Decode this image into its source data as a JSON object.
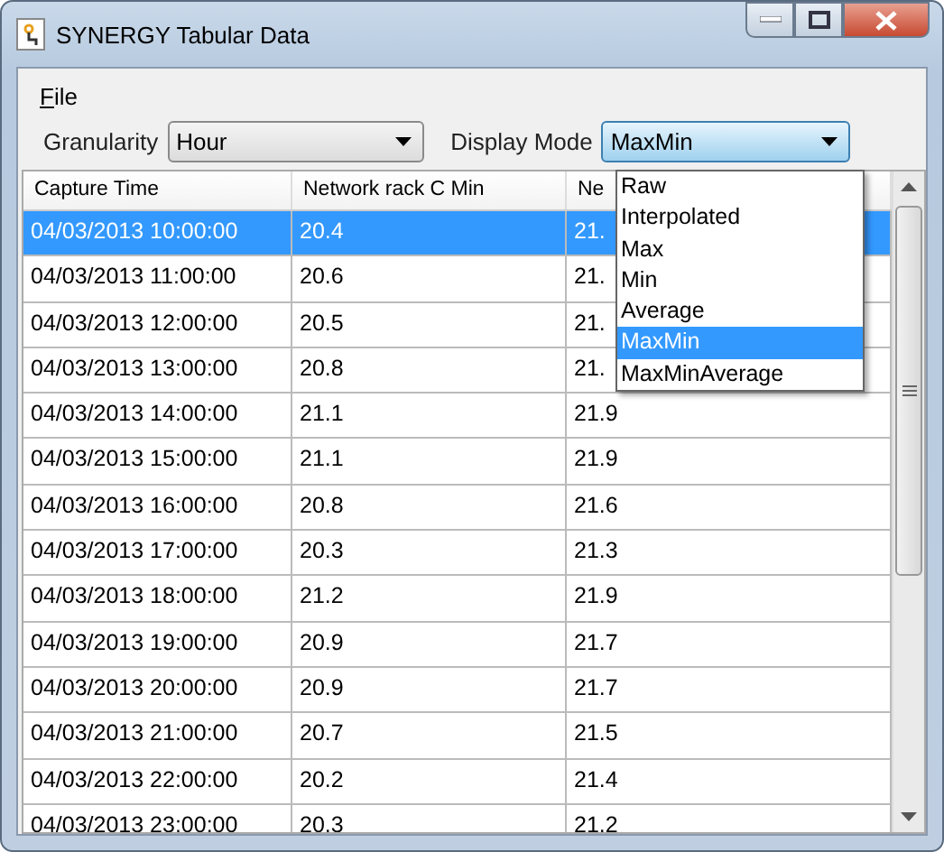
{
  "window": {
    "title": "SYNERGY Tabular Data"
  },
  "menu": [
    {
      "label": "File"
    }
  ],
  "granularity": {
    "label": "Granularity",
    "value": "Hour"
  },
  "display_mode": {
    "label": "Display Mode",
    "value": "MaxMin",
    "expanded": true,
    "options": [
      {
        "label": "Raw",
        "selected": false
      },
      {
        "label": "Interpolated",
        "selected": false
      },
      {
        "label": "Max",
        "selected": false
      },
      {
        "label": "Min",
        "selected": false
      },
      {
        "label": "Average",
        "selected": false
      },
      {
        "label": "MaxMin",
        "selected": true
      },
      {
        "label": "MaxMinAverage",
        "selected": false
      }
    ]
  },
  "table": {
    "columns": [
      "Capture Time",
      "Network rack C Min",
      "Ne"
    ],
    "rows": [
      {
        "cells": [
          "04/03/2013 10:00:00",
          "20.4",
          "21."
        ],
        "selected": true
      },
      {
        "cells": [
          "04/03/2013 11:00:00",
          "20.6",
          "21."
        ],
        "selected": false
      },
      {
        "cells": [
          "04/03/2013 12:00:00",
          "20.5",
          "21."
        ],
        "selected": false
      },
      {
        "cells": [
          "04/03/2013 13:00:00",
          "20.8",
          "21."
        ],
        "selected": false
      },
      {
        "cells": [
          "04/03/2013 14:00:00",
          "21.1",
          "21.9"
        ],
        "selected": false
      },
      {
        "cells": [
          "04/03/2013 15:00:00",
          "21.1",
          "21.9"
        ],
        "selected": false
      },
      {
        "cells": [
          "04/03/2013 16:00:00",
          "20.8",
          "21.6"
        ],
        "selected": false
      },
      {
        "cells": [
          "04/03/2013 17:00:00",
          "20.3",
          "21.3"
        ],
        "selected": false
      },
      {
        "cells": [
          "04/03/2013 18:00:00",
          "21.2",
          "21.9"
        ],
        "selected": false
      },
      {
        "cells": [
          "04/03/2013 19:00:00",
          "20.9",
          "21.7"
        ],
        "selected": false
      },
      {
        "cells": [
          "04/03/2013 20:00:00",
          "20.9",
          "21.7"
        ],
        "selected": false
      },
      {
        "cells": [
          "04/03/2013 21:00:00",
          "20.7",
          "21.5"
        ],
        "selected": false
      },
      {
        "cells": [
          "04/03/2013 22:00:00",
          "20.2",
          "21.4"
        ],
        "selected": false
      },
      {
        "cells": [
          "04/03/2013 23:00:00",
          "20.3",
          "21.2"
        ],
        "selected": false
      }
    ]
  }
}
